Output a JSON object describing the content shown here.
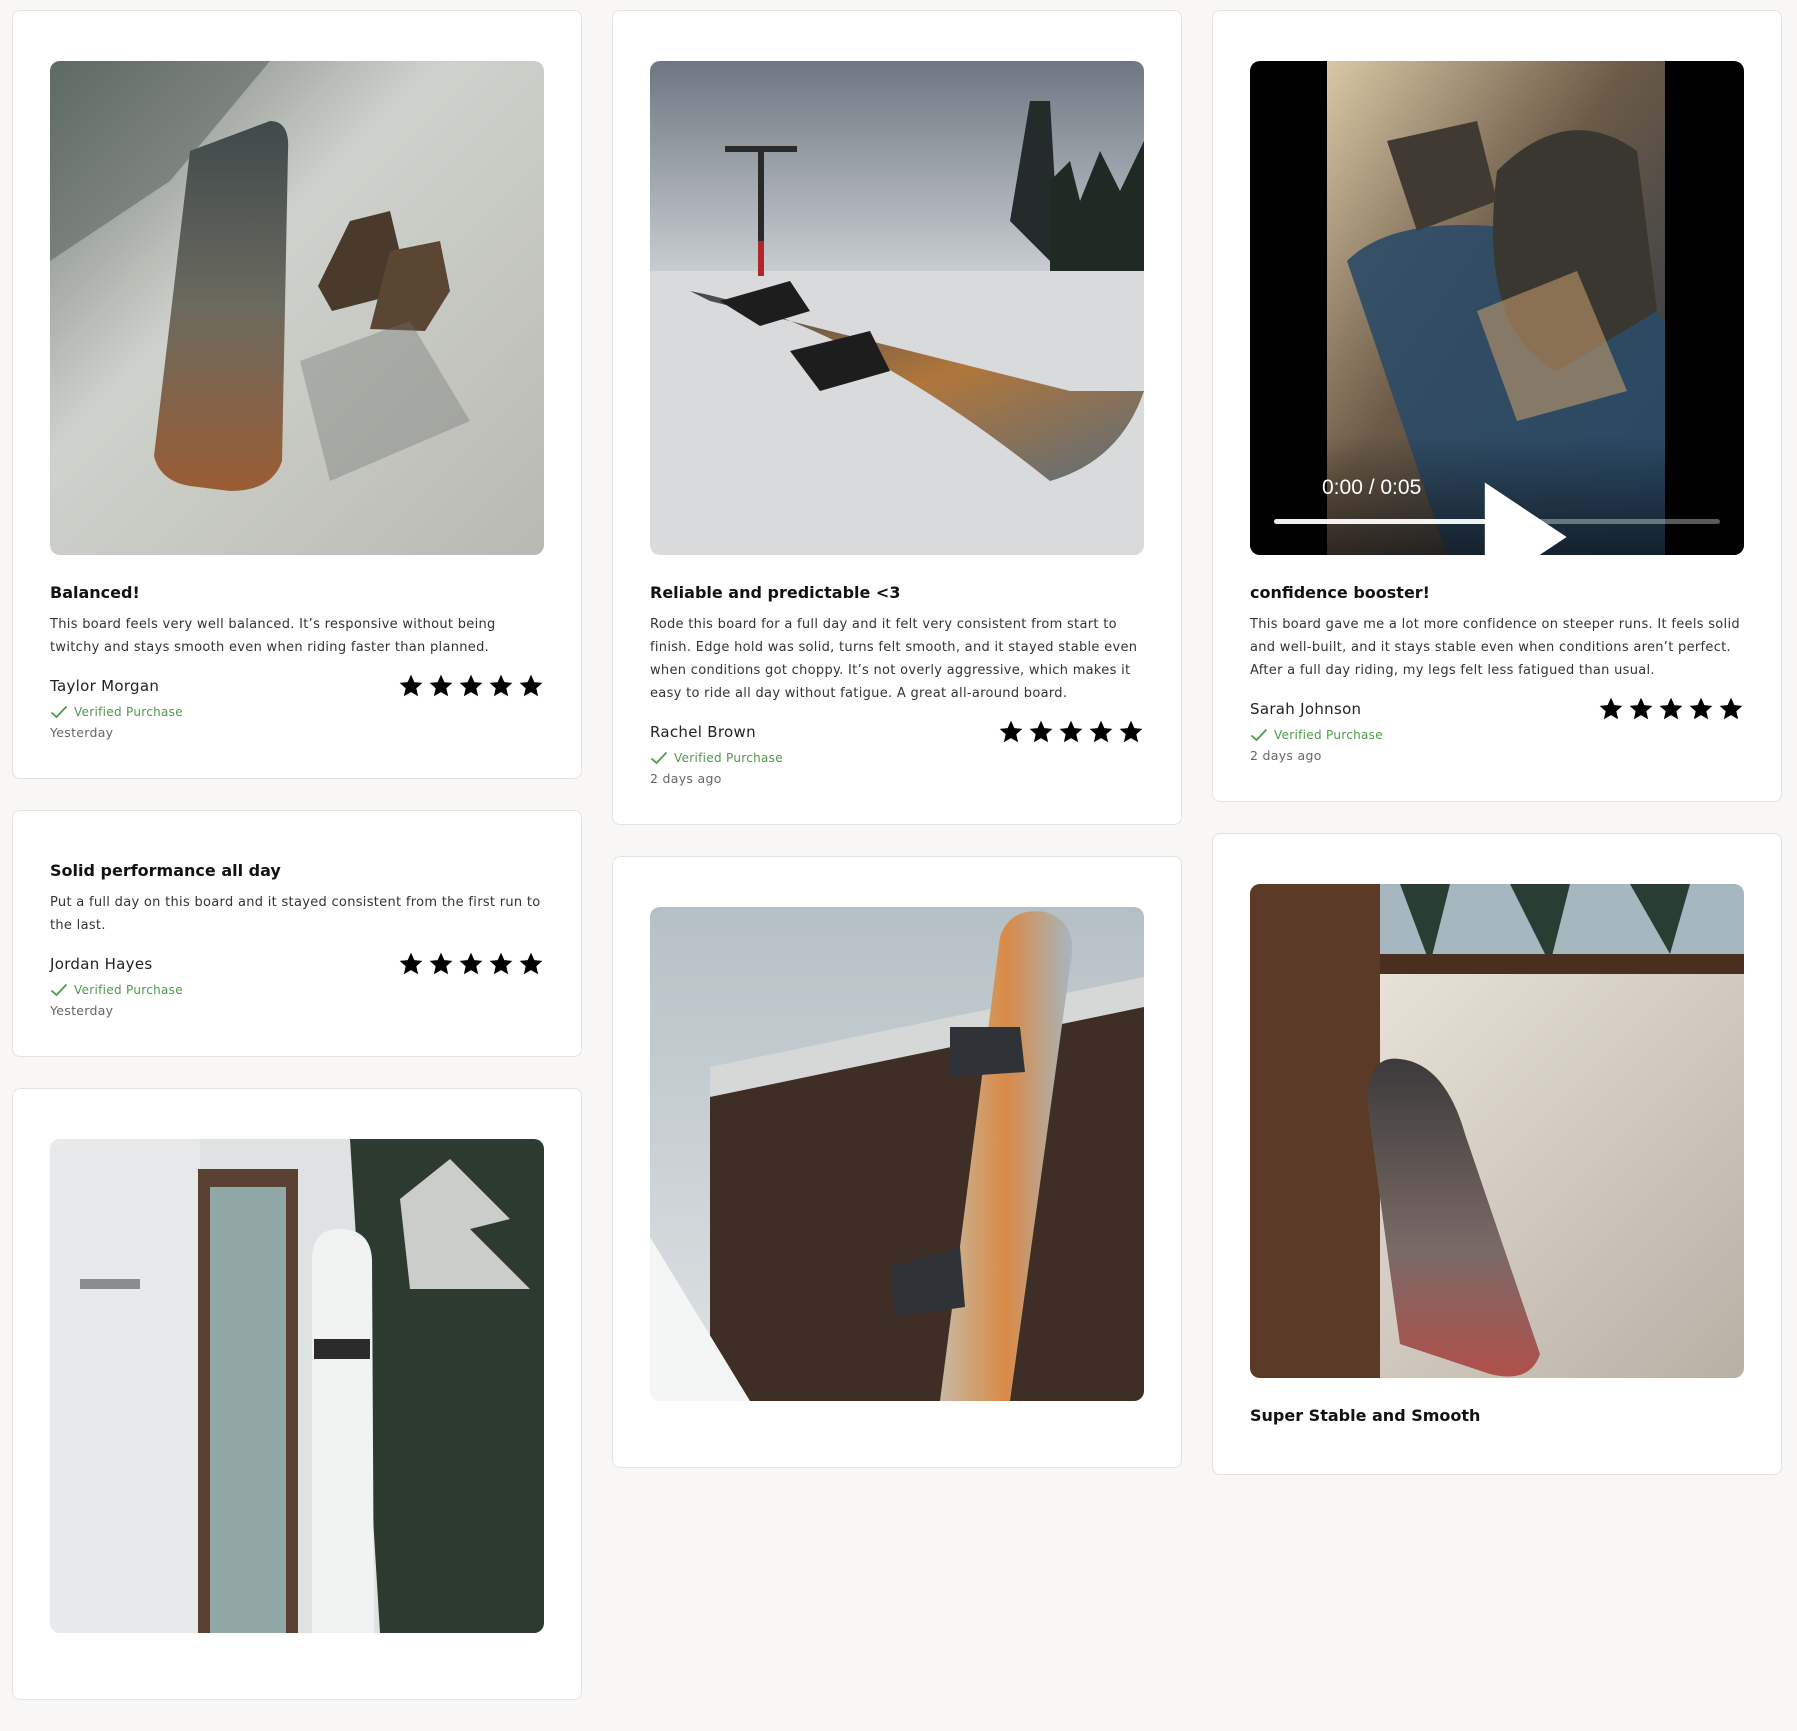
{
  "icons": {
    "star": "star-icon",
    "verified": "checkmark-icon",
    "play": "play-icon",
    "mute": "volume-mute-icon",
    "fullscreen": "fullscreen-icon",
    "more": "more-vertical-icon"
  },
  "colors": {
    "verified": "#4c9a4c",
    "star": "#000000"
  },
  "reviews": [
    {
      "title": "Balanced!",
      "body": "This board feels very well balanced. It’s responsive without being twitchy and stays smooth even when riding faster than planned.",
      "author": "Taylor Morgan",
      "rating": 5,
      "verified_label": "Verified Purchase",
      "date": "Yesterday",
      "media": "photo"
    },
    {
      "title": "Solid performance all day",
      "body": "Put a full day on this board and it stayed consistent from the first run to the last.",
      "author": "Jordan Hayes",
      "rating": 5,
      "verified_label": "Verified Purchase",
      "date": "Yesterday",
      "media": "none"
    },
    {
      "title": "Reliable and predictable <3",
      "body": "Rode this board for a full day and it felt very consistent from start to finish. Edge hold was solid, turns felt smooth, and it stayed stable even when conditions got choppy. It’s not overly aggressive, which makes it easy to ride all day without fatigue. A great all-around board.",
      "author": "Rachel Brown",
      "rating": 5,
      "verified_label": "Verified Purchase",
      "date": "2 days ago",
      "media": "photo"
    },
    {
      "title": "confidence booster!",
      "body": "This board gave me a lot more confidence on steeper runs. It feels solid and well-built, and it stays stable even when conditions aren’t perfect. After a full day riding, my legs felt less fatigued than usual.",
      "author": "Sarah Johnson",
      "rating": 5,
      "verified_label": "Verified Purchase",
      "date": "2 days ago",
      "media": "video",
      "video": {
        "time": "0:00 / 0:05",
        "progress": 0.56
      }
    },
    {
      "title": "Super Stable and Smooth",
      "media": "photo"
    }
  ]
}
